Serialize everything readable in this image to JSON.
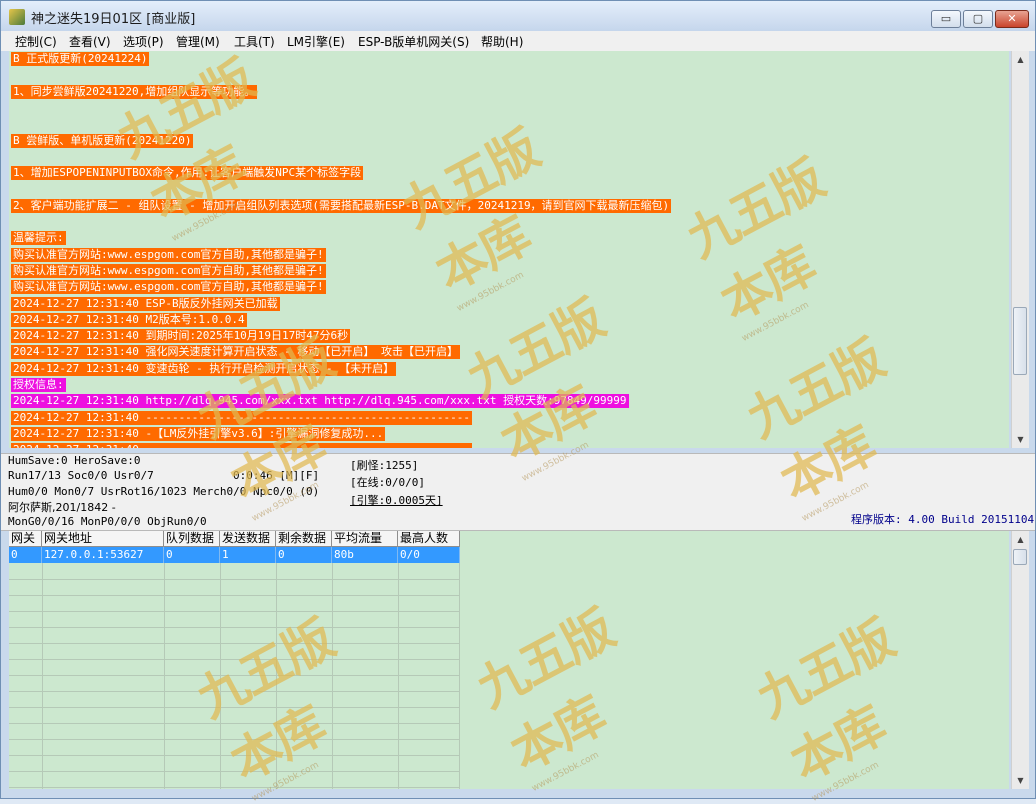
{
  "window": {
    "title": "神之迷失19日01区 [商业版]",
    "controls": {
      "minimize": "▭",
      "maximize": "▢",
      "close": "✕"
    }
  },
  "menu": [
    "控制(C)",
    "查看(V)",
    "选项(P)",
    "管理(M)",
    "工具(T)",
    "LM引擎(E)",
    "ESP-B版单机网关(S)",
    "帮助(H)"
  ],
  "log_lines": [
    {
      "text": "B 正式版更新(20241224)",
      "color": "orange"
    },
    {
      "text": "",
      "color": "none"
    },
    {
      "text": "1、同步尝鲜版20241220,增加组队显示等功能。",
      "color": "orange"
    },
    {
      "text": "",
      "color": "none"
    },
    {
      "text": "",
      "color": "none"
    },
    {
      "text": "B 尝鲜版、单机版更新(20241220)",
      "color": "orange"
    },
    {
      "text": "",
      "color": "none"
    },
    {
      "text": "1、增加ESPOPENINPUTBOX命令,作用:让客户端触发NPC某个标签字段",
      "color": "orange"
    },
    {
      "text": "",
      "color": "none"
    },
    {
      "text": "2、客户端功能扩展二 - 组队设置 - 增加开启组队列表选项(需要搭配最新ESP-B.DAT文件，20241219，请到官网下载最新压缩包)",
      "color": "orange"
    },
    {
      "text": "",
      "color": "none"
    },
    {
      "text": "温馨提示:",
      "color": "orange"
    },
    {
      "text": "购买认准官方网站:www.espgom.com官方自助,其他都是骗子!",
      "color": "orange"
    },
    {
      "text": "购买认准官方网站:www.espgom.com官方自助,其他都是骗子!",
      "color": "orange"
    },
    {
      "text": "购买认准官方网站:www.espgom.com官方自助,其他都是骗子!",
      "color": "orange"
    },
    {
      "text": "2024-12-27 12:31:40 ESP-B版反外挂网关已加载",
      "color": "orange"
    },
    {
      "text": "2024-12-27 12:31:40 M2版本号:1.0.0.4",
      "color": "orange"
    },
    {
      "text": "2024-12-27 12:31:40 到期时间:2025年10月19日17时47分6秒",
      "color": "orange"
    },
    {
      "text": "2024-12-27 12:31:40 强化网关速度计算开启状态 - 移动【已开启】 攻击【已开启】",
      "color": "orange"
    },
    {
      "text": "2024-12-27 12:31:40 变速齿轮 - 执行开启检测开启状态 - 【未开启】",
      "color": "orange"
    },
    {
      "text": "授权信息:",
      "color": "magenta"
    },
    {
      "text": "2024-12-27 12:31:40 http://dlq.945.com/xxx.txt http://dlq.945.com/xxx.txt 授权天数:97849/99999",
      "color": "magenta"
    },
    {
      "text": "2024-12-27 12:31:40 -------------------------------------------------",
      "color": "orange"
    },
    {
      "text": "2024-12-27 12:31:40 -【LM反外挂引擎v3.6】:引擎漏洞修复成功...",
      "color": "orange"
    },
    {
      "text": "2024-12-27 12:31:40 -------------------------------------------------",
      "color": "orange"
    }
  ],
  "status": {
    "line1": "HumSave:0 HeroSave:0",
    "line2": "Run17/13 Soc0/0 Usr0/7",
    "timer": "0:0:46 [M][F]",
    "line3": "Hum0/0 Mon0/7 UsrRot16/1023 Merch0/0 Npc0/0 (0)",
    "line4": "阿尔萨斯,201/1842 -",
    "line5": "MonG0/0/16 MonP0/0/0 ObjRun0/0",
    "refresh": "[刷怪:1255]",
    "online": "[在线:0/0/0]",
    "engine": "[引擎:0.0005天]",
    "version": "程序版本: 4.00 Build 20151104"
  },
  "grid": {
    "columns": [
      "网关",
      "网关地址",
      "队列数据",
      "发送数据",
      "剩余数据",
      "平均流量",
      "最高人数"
    ],
    "rows": [
      [
        "0",
        "127.0.0.1:53627",
        "0",
        "1",
        "0",
        "80b",
        "0/0"
      ]
    ]
  },
  "watermark": {
    "main": "九五版本库",
    "url": "www.95bbk.com"
  },
  "colors": {
    "log_bg": "#cce8cf",
    "orange": "#ff6a00",
    "magenta": "#ee10e0",
    "selected_row": "#3399ff"
  }
}
